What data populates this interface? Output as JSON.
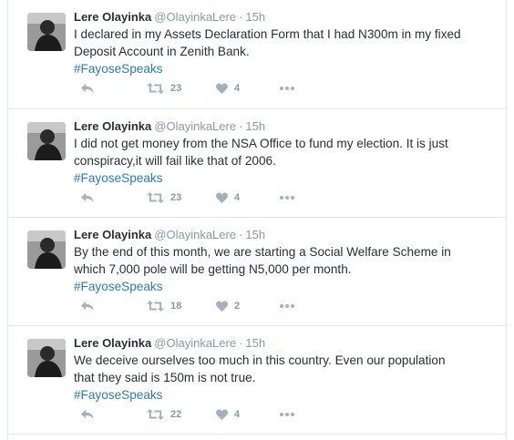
{
  "colors": {
    "link": "#2b7bb9",
    "muted": "#8899a6",
    "text": "#292f33",
    "border": "#e1e8ed"
  },
  "tweets": [
    {
      "name": "Lere Olayinka",
      "handle": "@OlayinkaLere",
      "dot": "·",
      "time": "15h",
      "line1": "I declared in my Assets Declaration Form that I had N300m in my fixed",
      "line2": "Deposit Account in Zenith Bank.",
      "hashtag": "#FayoseSpeaks",
      "retweets": "23",
      "likes": "4"
    },
    {
      "name": "Lere Olayinka",
      "handle": "@OlayinkaLere",
      "dot": "·",
      "time": "15h",
      "line1": "I did not get money from the NSA Office to fund my election. It is just",
      "line2": "conspiracy,it will fail like that of 2006.",
      "hashtag": "#FayoseSpeaks",
      "retweets": "23",
      "likes": "4"
    },
    {
      "name": "Lere Olayinka",
      "handle": "@OlayinkaLere",
      "dot": "·",
      "time": "15h",
      "line1": "By the end of this month, we are starting a Social Welfare Scheme in",
      "line2": "which 7,000 pole will be getting N5,000 per month.",
      "hashtag": "#FayoseSpeaks",
      "retweets": "18",
      "likes": "2"
    },
    {
      "name": "Lere Olayinka",
      "handle": "@OlayinkaLere",
      "dot": "·",
      "time": "15h",
      "line1": "We deceive ourselves too much in this country. Even our population",
      "line2": "that they said is 150m is not true.",
      "hashtag": "#FayoseSpeaks",
      "retweets": "22",
      "likes": "4"
    }
  ]
}
